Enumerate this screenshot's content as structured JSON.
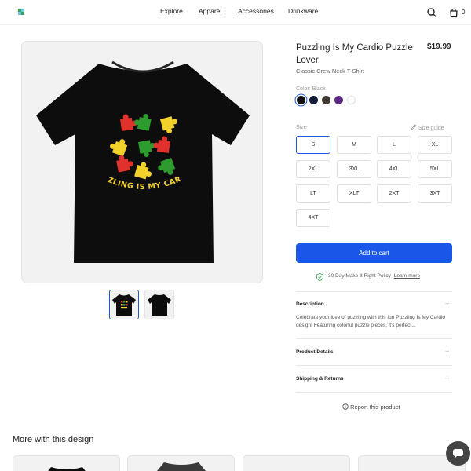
{
  "header": {
    "nav": [
      "Explore",
      "Apparel",
      "Accessories",
      "Drinkware"
    ],
    "cart_count": "0",
    "icons": [
      "logo-icon",
      "search-icon",
      "cart-icon"
    ]
  },
  "product": {
    "title": "Puzzling Is My Cardio Puzzle Lover",
    "price": "$19.99",
    "subtitle": "Classic Crew Neck T-Shirt",
    "print_text": "PUZZLING IS MY CARDIO",
    "color_label": "Color: Black",
    "colors": [
      {
        "name": "Black",
        "hex": "#111111",
        "selected": true
      },
      {
        "name": "Navy",
        "hex": "#131c3a",
        "selected": false
      },
      {
        "name": "Dark Heather",
        "hex": "#3f3a33",
        "selected": false
      },
      {
        "name": "Purple",
        "hex": "#5b2a82",
        "selected": false
      },
      {
        "name": "White",
        "hex": "#ffffff",
        "selected": false
      }
    ],
    "size_label": "Size",
    "size_guide": "Size guide",
    "sizes": [
      "S",
      "M",
      "L",
      "XL",
      "2XL",
      "3XL",
      "4XL",
      "5XL",
      "LT",
      "XLT",
      "2XT",
      "3XT",
      "4XT"
    ],
    "selected_size": "S",
    "add_to_cart": "Add to cart",
    "policy": "30 Day Make It Right Policy",
    "learn_more": "Learn more",
    "description_title": "Description",
    "description": "Celebrate your love of puzzling with this fun Puzzling Is My Cardio design! Featuring colorful puzzle pieces, it's perfect...",
    "product_details": "Product Details",
    "shipping_returns": "Shipping & Returns",
    "report": "Report this product"
  },
  "more_section": {
    "title": "More with this design"
  },
  "colors": {
    "accent": "#1a57e8",
    "puzzle_red": "#e0312d",
    "puzzle_green": "#2e9b2f",
    "puzzle_yellow": "#f2d22a"
  }
}
